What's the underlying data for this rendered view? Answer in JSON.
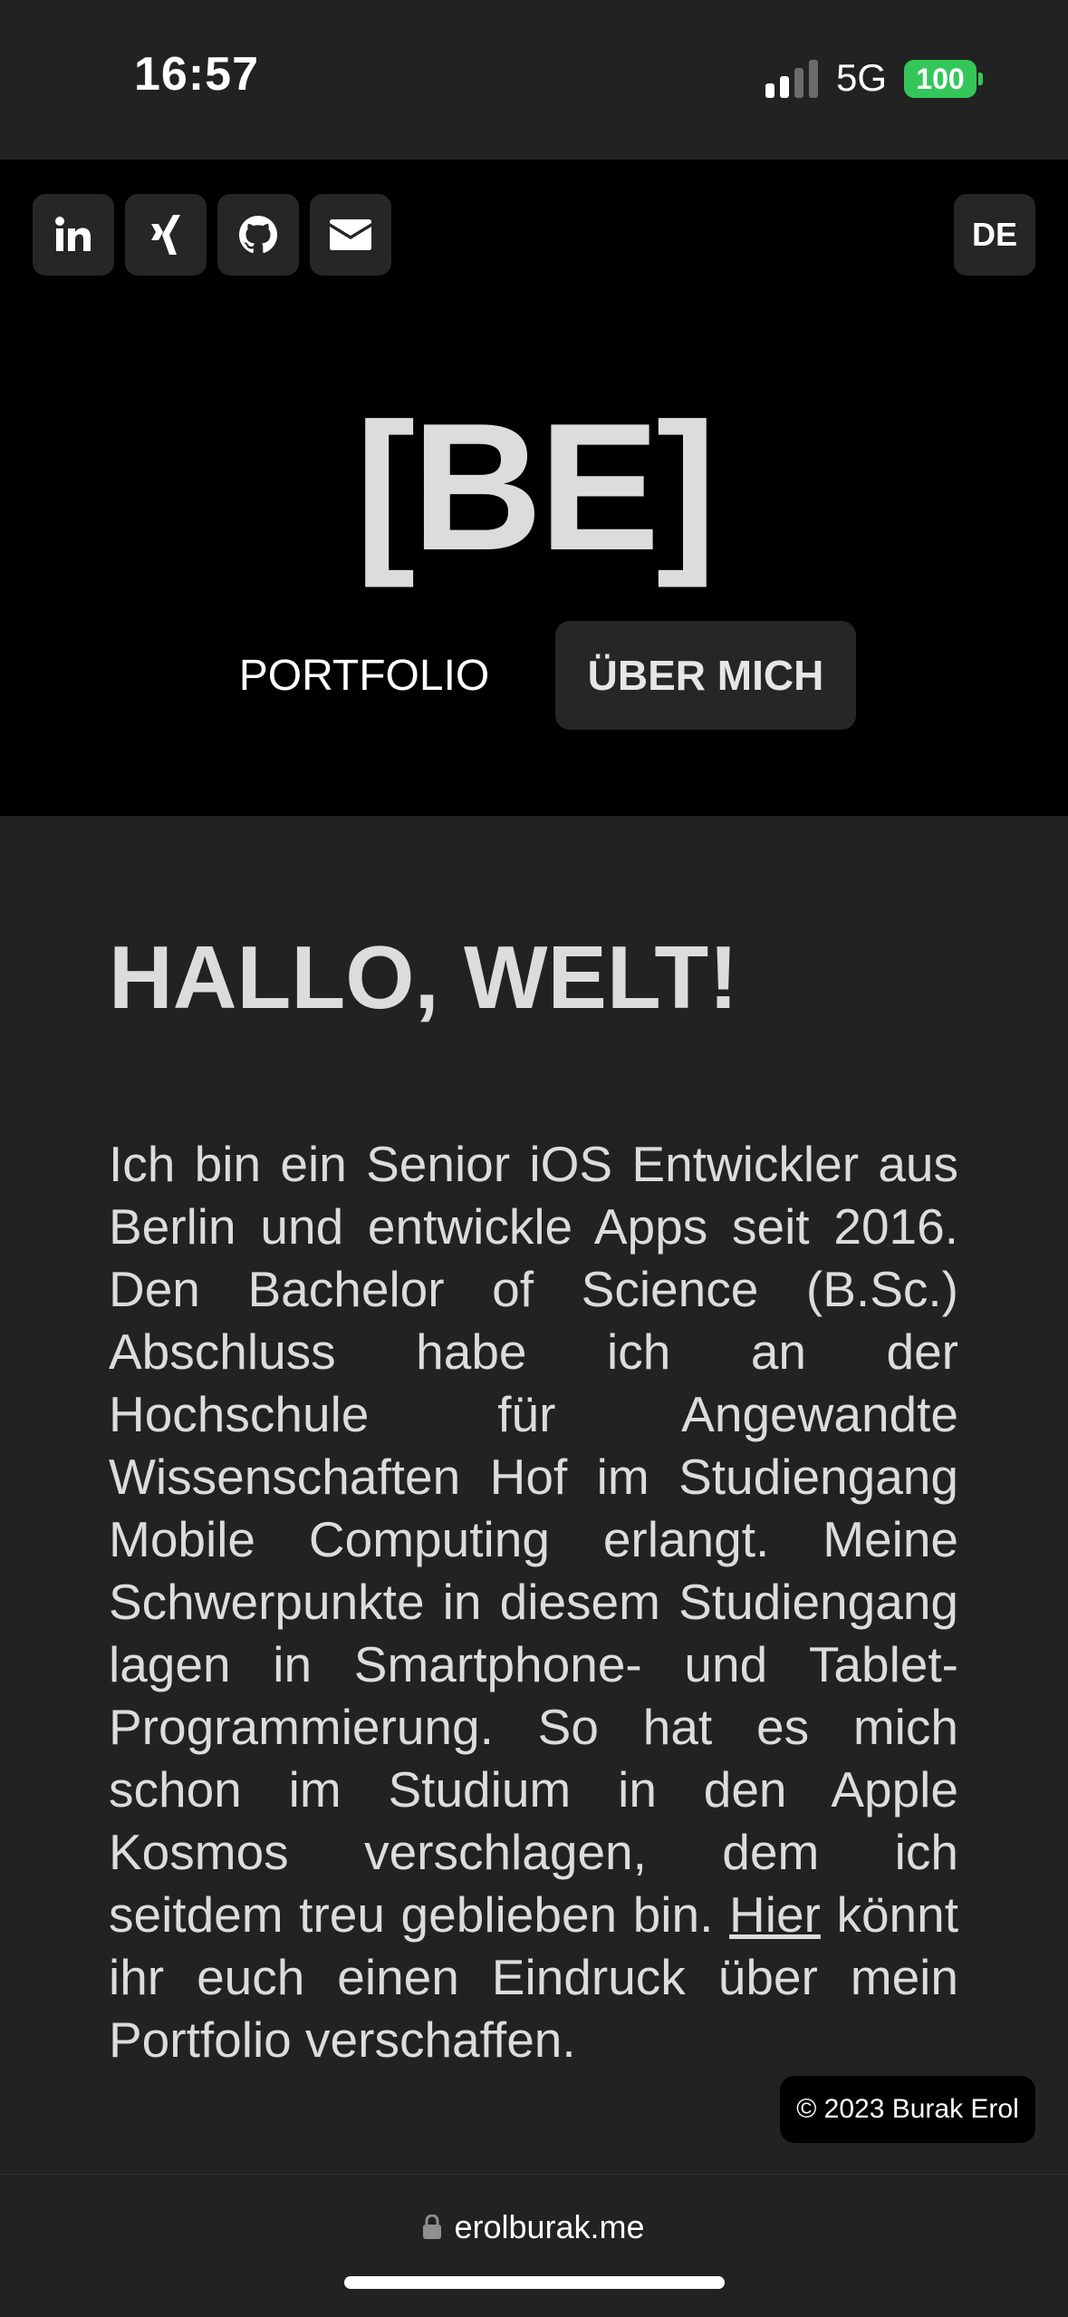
{
  "status_bar": {
    "time": "16:57",
    "network": "5G",
    "battery": "100"
  },
  "social": [
    {
      "name": "linkedin",
      "icon": "linkedin-icon"
    },
    {
      "name": "xing",
      "icon": "xing-icon"
    },
    {
      "name": "github",
      "icon": "github-icon"
    },
    {
      "name": "email",
      "icon": "envelope-icon"
    }
  ],
  "header": {
    "language": "DE",
    "logo": "[BE]",
    "nav": {
      "portfolio": "PORTFOLIO",
      "about": "ÜBER MICH"
    }
  },
  "content": {
    "title": "HALLO, WELT!",
    "paragraph": "Ich bin ein Senior iOS Entwickler aus Berlin und entwickle Apps seit 2016. Den Bachelor of Science (B.Sc.) Abschluss habe ich an der Hochschule für Angewandte Wissenschaften Hof im Studiengang Mobile Computing erlangt. Meine Schwerpunkte in diesem Studiengang lagen in Smartphone- und Tablet-Programmierung. So hat es mich schon im Studium in den Apple Kosmos verschlagen, dem ich seitdem treu geblieben bin.",
    "link_text": "Hier",
    "paragraph_end": "könnt ihr euch einen Eindruck über mein Portfolio verschaffen."
  },
  "footer": {
    "copyright": "© 2023 Burak Erol"
  },
  "browser": {
    "url": "erolburak.me"
  },
  "colors": {
    "battery": "#33c759",
    "hero_bg": "#000000",
    "page_bg": "#222223"
  }
}
